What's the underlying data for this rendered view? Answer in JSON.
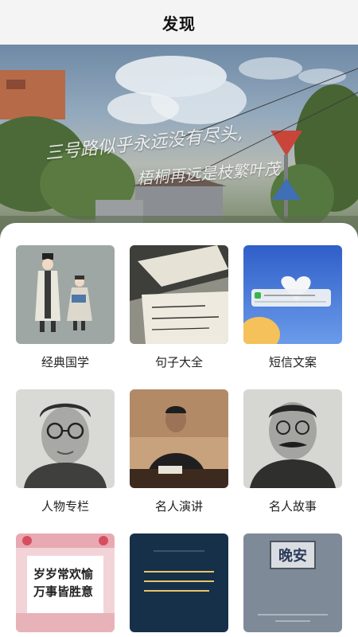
{
  "header": {
    "title": "发现"
  },
  "banner": {
    "line1": "三号路似乎永远没有尽头,",
    "line2": "梧桐再远是枝繁叶茂"
  },
  "categories": [
    {
      "label": "经典国学",
      "icon": "scholars-illustration"
    },
    {
      "label": "句子大全",
      "icon": "handwritten-note-photo"
    },
    {
      "label": "短信文案",
      "icon": "heart-cloud-photo"
    },
    {
      "label": "人物专栏",
      "icon": "portrait-glasses-photo"
    },
    {
      "label": "名人演讲",
      "icon": "speaker-portrait-photo"
    },
    {
      "label": "名人故事",
      "icon": "mustache-portrait-photo"
    },
    {
      "label": "",
      "icon": "calligraphy-poster",
      "thumb_text": "岁岁常欢愉\n万事皆胜意"
    },
    {
      "label": "",
      "icon": "dark-quote-poster"
    },
    {
      "label": "",
      "icon": "night-sign-poster",
      "thumb_text": "晚安"
    }
  ]
}
